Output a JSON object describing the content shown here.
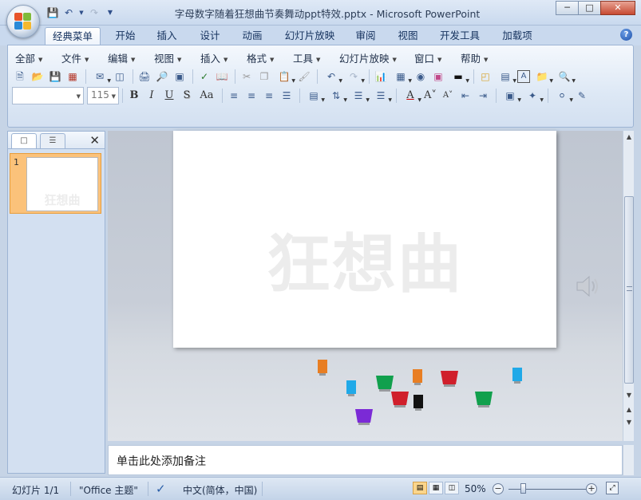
{
  "window": {
    "title": "字母数字随着狂想曲节奏舞动ppt特效.pptx - Microsoft PowerPoint",
    "minimize_icon": "minimize-icon",
    "maximize_icon": "restore-icon",
    "close_icon": "close-icon"
  },
  "tabs": [
    "经典菜单",
    "开始",
    "插入",
    "设计",
    "动画",
    "幻灯片放映",
    "审阅",
    "视图",
    "开发工具",
    "加载项"
  ],
  "active_tab": "经典菜单",
  "classic_menu": [
    "全部",
    "文件",
    "编辑",
    "视图",
    "插入",
    "格式",
    "工具",
    "幻灯片放映",
    "窗口",
    "帮助"
  ],
  "font": {
    "name_value": "",
    "size_value": "115"
  },
  "format_buttons": {
    "bold": "B",
    "italic": "I",
    "underline": "U",
    "shadow": "S",
    "case": "Aa"
  },
  "slide_panel": {
    "slide_number": "1",
    "thumb_text": "狂想曲"
  },
  "slide": {
    "title": "狂想曲"
  },
  "notes": {
    "placeholder": "单击此处添加备注"
  },
  "status": {
    "slide_info": "幻灯片 1/1",
    "theme": "\"Office 主题\"",
    "language": "中文(简体，中国)",
    "zoom": "50%"
  },
  "cups": [
    {
      "color": "#e87e23"
    },
    {
      "color": "#20a9e8"
    },
    {
      "color": "#11a04d"
    },
    {
      "color": "#e87e23"
    },
    {
      "color": "#d01f2b"
    },
    {
      "color": "#d01f2b"
    },
    {
      "color": "#121212"
    },
    {
      "color": "#20a9e8"
    },
    {
      "color": "#11a04d"
    },
    {
      "color": "#7b2ad6"
    }
  ],
  "colors": {
    "active_thumb": "#fbc27a",
    "ribbon": "#dde8f5"
  }
}
